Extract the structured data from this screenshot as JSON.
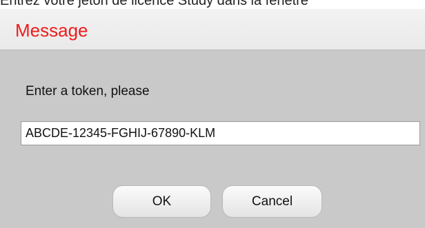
{
  "background": {
    "text": "Entrez votre jeton de licence Study dans la fenêtre"
  },
  "dialog": {
    "title": "Message",
    "prompt": "Enter a token, please",
    "token_input": {
      "value": "ABCDE-12345-FGHIJ-67890-KLM"
    },
    "buttons": {
      "ok_label": "OK",
      "cancel_label": "Cancel"
    },
    "colors": {
      "title": "#ee1c1c",
      "body_background": "#c9c9c9",
      "titlebar_background": "#efefef"
    }
  }
}
